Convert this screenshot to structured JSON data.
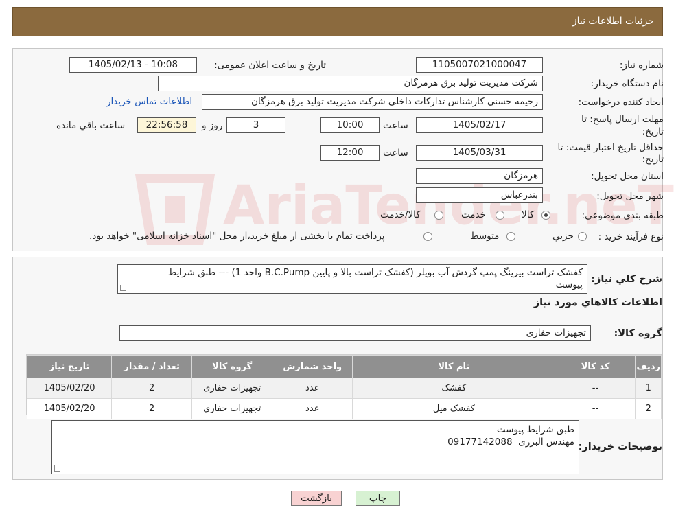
{
  "header": {
    "title": "جزئیات اطلاعات نیاز"
  },
  "form": {
    "need_number_label": "شماره نیاز:",
    "need_number": "1105007021000047",
    "announce_label": "تاریخ و ساعت اعلان عمومی:",
    "announce_value": "1405/02/13 - 10:08",
    "buyer_org_label": "نام دستگاه خریدار:",
    "buyer_org": "شرکت مدیریت تولید برق هرمزگان",
    "creator_label": "ایجاد کننده درخواست:",
    "creator": "رحیمه حسنی کارشناس تدارکات داخلی شرکت مدیریت تولید برق هرمزگان",
    "contact_link": "اطلاعات تماس خریدار",
    "reply_deadline_label_1": "مهلت ارسال پاسخ: تا",
    "reply_deadline_label_2": "تاریخ:",
    "reply_date": "1405/02/17",
    "time_label": "ساعت",
    "reply_time": "10:00",
    "days_value": "3",
    "days_label": "روز و",
    "remaining_time": "22:56:58",
    "remaining_label": "ساعت باقي مانده",
    "price_validity_label_1": "حداقل تاریخ اعتبار قیمت: تا",
    "price_validity_label_2": "تاریخ:",
    "price_date": "1405/03/31",
    "price_time": "12:00",
    "province_label": "استان محل تحویل:",
    "province": "هرمزگان",
    "city_label": "شهر محل تحویل:",
    "city": "بندرعباس",
    "category_label": "طبقه بندی موضوعی:",
    "category_options": [
      "کالا",
      "خدمت",
      "کالا/خدمت"
    ],
    "category_selected": "کالا",
    "process_label": "نوع فرآیند خرید :",
    "process_options": [
      "جزيي",
      "متوسط"
    ],
    "process_note": "پرداخت تمام یا بخشی از مبلغ خرید،از محل \"اسناد خزانه اسلامی\" خواهد بود."
  },
  "description": {
    "label": "شرح کلي نياز:",
    "text_line1": "کفشک تراست بیرینگ پمپ گردش آب بویلر (کفشک تراست بالا و پایین B.C.Pump واحد 1) --- طبق شرایط",
    "text_line2": "پیوست"
  },
  "goods": {
    "section_title": "اطلاعات کالاهاي مورد نياز",
    "group_label": "گروه کالا:",
    "group_value": "تجهیزات حفاری",
    "columns": [
      "رديف",
      "کد کالا",
      "نام کالا",
      "واحد شمارش",
      "گروه کالا",
      "تعداد / مقدار",
      "تاريخ نياز"
    ],
    "rows": [
      [
        "1",
        "--",
        "کفشک",
        "عدد",
        "تجهیزات حفاری",
        "2",
        "1405/02/20"
      ],
      [
        "2",
        "--",
        "کفشک میل",
        "عدد",
        "تجهیزات حفاری",
        "2",
        "1405/02/20"
      ]
    ]
  },
  "buyer_notes": {
    "label": "توضیحات خریدار:",
    "line1": "طبق شرایط پیوست",
    "line2": "مهندس البرزی  09177142088"
  },
  "buttons": {
    "print": "چاپ",
    "back": "بازگشت"
  },
  "watermark": {
    "text": "AriaTender.neT"
  },
  "colors": {
    "header": "#8b6a3e",
    "back_button": "#f8d2d2",
    "print_button": "#d7f1d2",
    "link": "#1a55b8"
  }
}
